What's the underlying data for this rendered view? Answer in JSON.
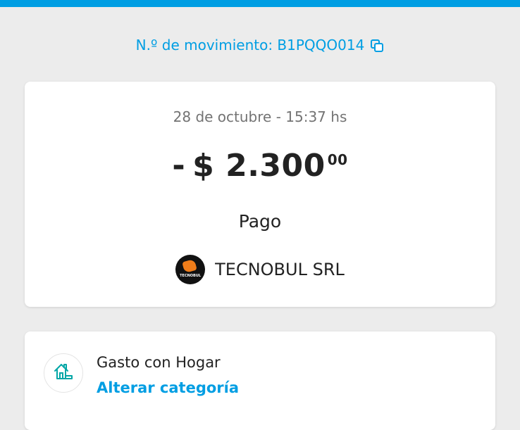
{
  "header": {
    "accent_color": "#009ee3"
  },
  "movement": {
    "label": "N.º de movimiento: B1PQQO014",
    "copy_icon": "copy-icon"
  },
  "transaction": {
    "datetime": "28 de octubre - 15:37 hs",
    "sign": "-",
    "amount_main": "$ 2.300",
    "amount_cents": "00",
    "type": "Pago",
    "merchant": {
      "name": "TECNOBUL SRL",
      "logo_text": "TECNOBUL",
      "logo_color": "#f07d1a"
    }
  },
  "category": {
    "title": "Gasto con Hogar",
    "change_link": "Alterar categoría",
    "icon": "home-icon",
    "icon_color": "#00a6a6"
  }
}
